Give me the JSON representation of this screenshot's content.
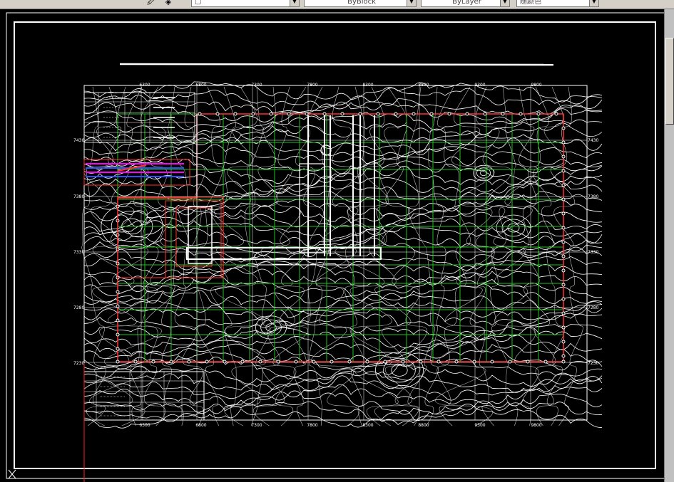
{
  "toolbar": {
    "linetype_value": "ByBlock",
    "lineweight_value": "ByLayer",
    "color_value": "随颜色",
    "layer_icon": "layer-icon",
    "stack_icon": "layers-stack-icon",
    "square_icon": "square-icon"
  },
  "drawing": {
    "top_axis": [
      "6300",
      "6800",
      "7300",
      "7800",
      "8300",
      "8800",
      "9300",
      "9800"
    ],
    "bottom_axis": [
      "6300",
      "6800",
      "7300",
      "7800",
      "8300",
      "8800",
      "9300",
      "9800"
    ],
    "left_axis": [
      "7430",
      "7380",
      "7330",
      "7280",
      "7230"
    ],
    "right_axis": [
      "7430",
      "7380",
      "7330",
      "7280",
      "7230"
    ],
    "colors": {
      "background": "#000000",
      "frame": "#ffffff",
      "boundary": "#ff3030",
      "grid_green": "#20c020",
      "contour": "#ffffff",
      "highlight_magenta": "#ff00ff",
      "highlight_blue": "#3050ff",
      "crosshair": "#ff2020"
    }
  }
}
